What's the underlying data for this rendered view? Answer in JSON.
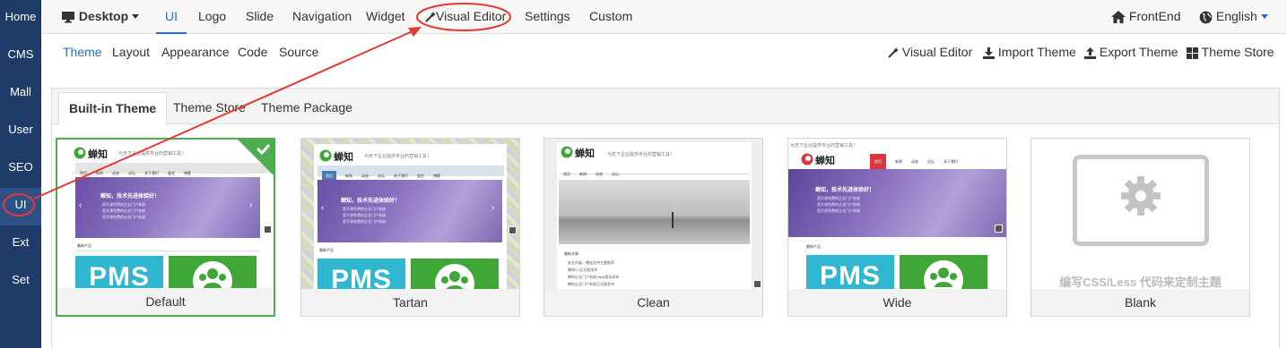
{
  "sidebar": {
    "items": [
      {
        "label": "Home"
      },
      {
        "label": "CMS"
      },
      {
        "label": "Mall"
      },
      {
        "label": "User"
      },
      {
        "label": "SEO"
      },
      {
        "label": "UI"
      },
      {
        "label": "Ext"
      },
      {
        "label": "Set"
      }
    ]
  },
  "topnav": {
    "device": "Desktop",
    "items": [
      "UI",
      "Logo",
      "Slide",
      "Navigation",
      "Widget",
      "Visual Editor",
      "Settings",
      "Custom"
    ],
    "frontend": "FrontEnd",
    "language": "English"
  },
  "subnav": {
    "items": [
      "Theme",
      "Layout",
      "Appearance",
      "Code",
      "Source"
    ],
    "actions": [
      "Visual Editor",
      "Import Theme",
      "Export Theme",
      "Theme Store"
    ]
  },
  "tabs": [
    "Built-in Theme",
    "Theme Store",
    "Theme Package"
  ],
  "themes": [
    {
      "name": "Default"
    },
    {
      "name": "Tartan"
    },
    {
      "name": "Clean"
    },
    {
      "name": "Wide"
    },
    {
      "name": "Blank"
    }
  ],
  "preview": {
    "logo": "蝉知",
    "slogan": "为天下企业提供专业的营销工具！",
    "nav": [
      "首页",
      "新闻",
      "动态",
      "论坛",
      "关于我们",
      "留言",
      "博客"
    ],
    "banner_title": "蝉知，技术先进体验好！",
    "banner_lines": [
      "是开源免费的企业门户系统",
      "是开源免费的企业门户系统",
      "是开源免费的企业门户系统"
    ],
    "section": "最新产品",
    "pms": "PMS",
    "news_section": "最新文章",
    "news_lines": [
      "安全升级，赠送支持主题推荐",
      "蝉知2.6正式版发布",
      "蝉知企业门户系统 Beta版本发布",
      "蝉知企业门户系统正式版发布"
    ],
    "blank_caption": "编写CSS/Less 代码来定制主题"
  },
  "colors": {
    "sidebar": "#1f3b67",
    "active": "#2a6ebb",
    "annotation": "#e53935",
    "selected": "#4cae4c"
  }
}
